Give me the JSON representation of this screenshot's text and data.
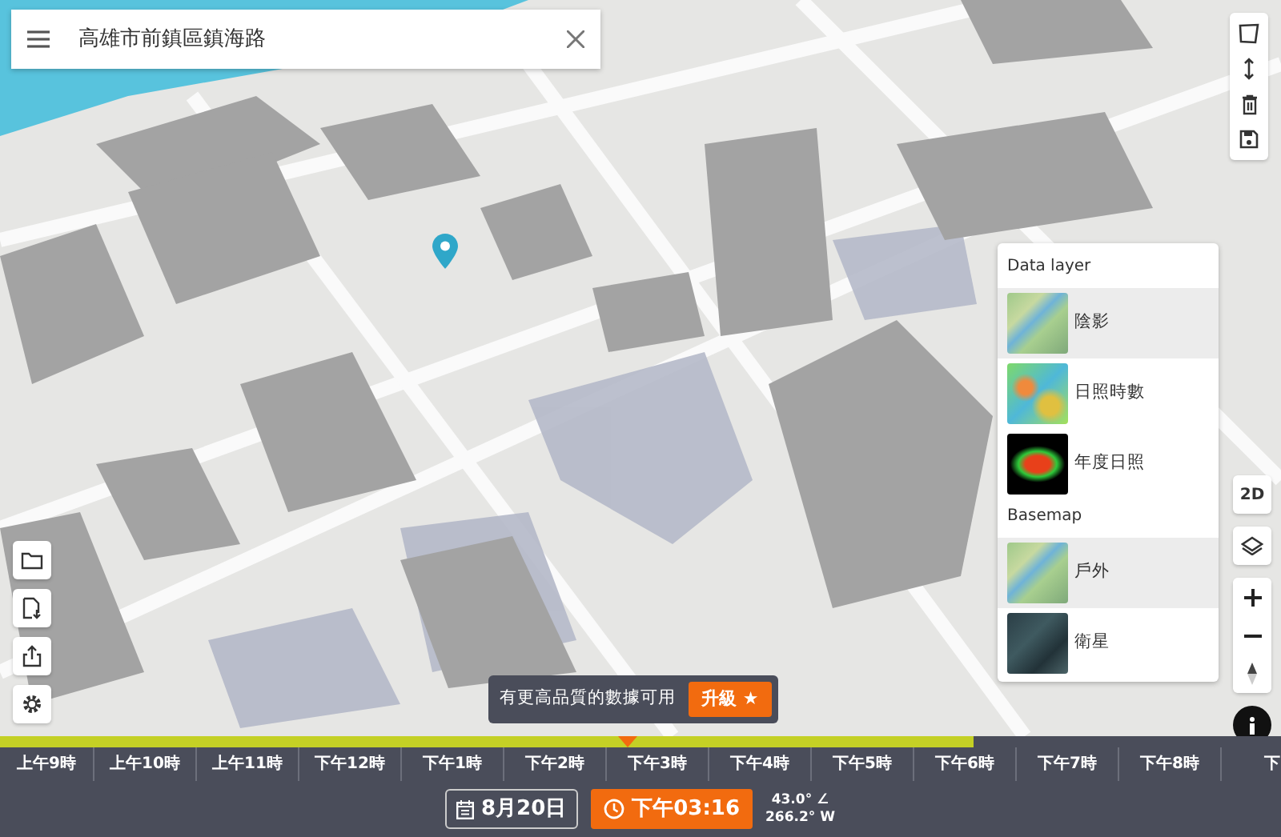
{
  "search": {
    "value": "高雄市前鎮區鎮海路"
  },
  "view_toggle": "2D",
  "layer_panel": {
    "sections": [
      {
        "title": "Data layer",
        "items": [
          {
            "label": "陰影",
            "selected": true,
            "kind": "terrain"
          },
          {
            "label": "日照時數",
            "selected": false,
            "kind": "heatmap"
          },
          {
            "label": "年度日照",
            "selected": false,
            "kind": "annual"
          }
        ]
      },
      {
        "title": "Basemap",
        "items": [
          {
            "label": "戶外",
            "selected": true,
            "kind": "terrain"
          },
          {
            "label": "衛星",
            "selected": false,
            "kind": "satellite"
          }
        ]
      }
    ]
  },
  "upgrade_banner": {
    "text": "有更高品質的數據可用",
    "button": "升級 ★"
  },
  "timeline": {
    "daylight": {
      "level": 0.76
    },
    "cursor": {
      "level": 0.49
    },
    "hours": [
      "上午9時",
      "上午10時",
      "上午11時",
      "下午12時",
      "下午1時",
      "下午2時",
      "下午3時",
      "下午4時",
      "下午5時",
      "下午6時",
      "下午7時",
      "下午8時",
      "下"
    ]
  },
  "date": "8月20日",
  "time": "下午03:16",
  "sun": {
    "altitude": "43.0° ∠",
    "azimuth": "266.2° W"
  }
}
